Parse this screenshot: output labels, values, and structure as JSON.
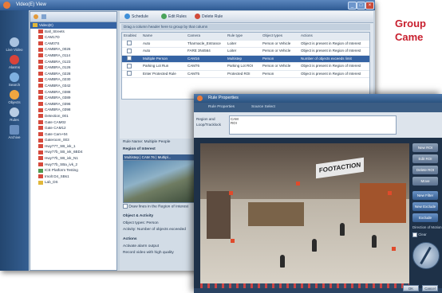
{
  "main_window": {
    "title": "Video(E) View",
    "left_rail": [
      "Live Video",
      "Alarms",
      "Search",
      "Objects",
      "Rules",
      "Archive"
    ],
    "tree_items": [
      "Video(E)",
      "Ball_Streets",
      "CAM17D",
      "CAM07S",
      "CAMBRA_0026",
      "CAMBRA_0114",
      "CAMBRA_0123",
      "CAMBRA_0126",
      "CAMBRA_0228",
      "CAMBRA_0230",
      "CAMBRA_0342",
      "CAMBRA_0388",
      "CAMBRA_0389",
      "CAMBRA_0396",
      "CAMBRA_0398",
      "Detection_001",
      "Gate CAM02",
      "Gate CAM12",
      "Gate Cam+04",
      "Gateroom_003",
      "Hwy777_SB_ivk_1",
      "Hwy77b_SB_ivk_6BD4",
      "Hwy77b_SB_ivk_N1",
      "Hwy77b_SBa_ivk_2",
      "ICE Platform Testing",
      "Imolt D4_SBs1",
      "Lab_DS"
    ]
  },
  "toolbar": {
    "schedule": "Schedule",
    "edit_rules": "Edit Rules",
    "delete_rule": "Delete Rule"
  },
  "rules_hint": "Drag a column header here to group by that column",
  "rules_table": {
    "columns": [
      "Enabled",
      "Name",
      "Camera",
      "Rule type",
      "Object types",
      "Actions"
    ],
    "rows": [
      {
        "name": "Auto",
        "camera": "Tharmacle_Entrance",
        "type": "Loiter",
        "object": "Person or Vehicle",
        "action": "Object is present in Region of Interest"
      },
      {
        "name": "Auto",
        "camera": "FARE 3N4564",
        "type": "Loiter",
        "object": "Person or Vehicle",
        "action": "Object is present in Region of Interest"
      },
      {
        "name": "Multiple Person",
        "camera": "CAM16",
        "type": "Multistep",
        "object": "Person",
        "action": "Number of objects exceeds limit"
      },
      {
        "name": "Parking Lot Run",
        "camera": "CAM76",
        "type": "Parking Lot ROI",
        "object": "Person or Vehicle",
        "action": "Object is present in Region of Interest"
      },
      {
        "name": "Enter Protected Rule",
        "camera": "CAM75",
        "type": "Protected ROI",
        "object": "Person",
        "action": "Object is present in Region of Interest"
      }
    ]
  },
  "properties": {
    "rule_label": "Rule Name: Multiple People",
    "region_label": "Region of Interest",
    "thumb_caption": "Multistep | CAM 76 | Multipl...",
    "draw_label": "Draw lines in the Region of Interest",
    "object_activity": "Object & Activity",
    "object_types": "Object types: Person",
    "activity": "Activity:     Number of objects exceeded",
    "actions": "Actions",
    "actions_line1": "Activate alarm output",
    "actions_line2": "Record video with high quality"
  },
  "editor_window": {
    "title": "Rule Properties",
    "tabs": [
      "Rule Properties",
      "Source Select"
    ],
    "field_label1": "Region and",
    "field_label2": "Loop/Tracklock",
    "field_value": "CAM\nROI",
    "sign_text": "FOOTACTION",
    "side_buttons": [
      "New ROI",
      "Edit ROI",
      "Delete ROI",
      "Move",
      "New Filter",
      "New Exclude",
      "Exclude"
    ],
    "compass_label": "Direction of Motion",
    "clear_label": "Clear",
    "ok": "OK",
    "cancel": "Cancel"
  },
  "heading_lines": [
    "Group",
    "Came"
  ],
  "colors": {
    "heading": "#c8202f",
    "selection": "#3563a3",
    "title_bar": "#2e5a93"
  }
}
